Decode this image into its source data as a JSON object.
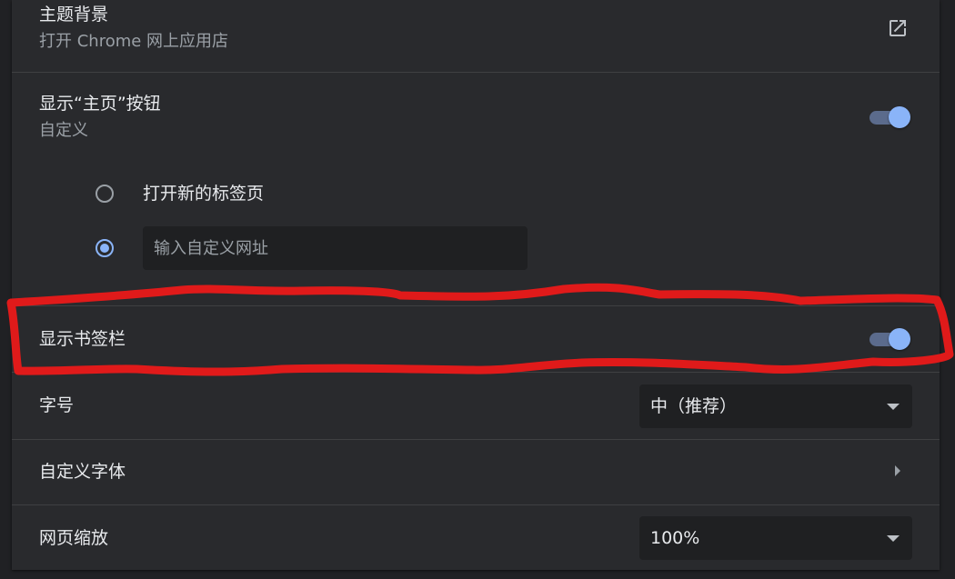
{
  "theme": {
    "title": "主题背景",
    "subtitle": "打开 Chrome 网上应用店",
    "icon": "open-in-new-icon"
  },
  "home_button": {
    "title": "显示“主页”按钮",
    "subtitle": "自定义",
    "enabled": true,
    "options": [
      {
        "label": "打开新的标签页",
        "selected": false
      },
      {
        "placeholder": "输入自定义网址",
        "value": "",
        "selected": true
      }
    ]
  },
  "bookmarks_bar": {
    "title": "显示书签栏",
    "enabled": true
  },
  "font_size": {
    "label": "字号",
    "selected": "中（推荐）"
  },
  "custom_fonts": {
    "label": "自定义字体",
    "icon": "chevron-right-icon"
  },
  "page_zoom": {
    "label": "网页缩放",
    "selected": "100%"
  },
  "colors": {
    "accent": "#8ab4f8",
    "background": "#292a2d",
    "annotation": "#e01a1a"
  }
}
